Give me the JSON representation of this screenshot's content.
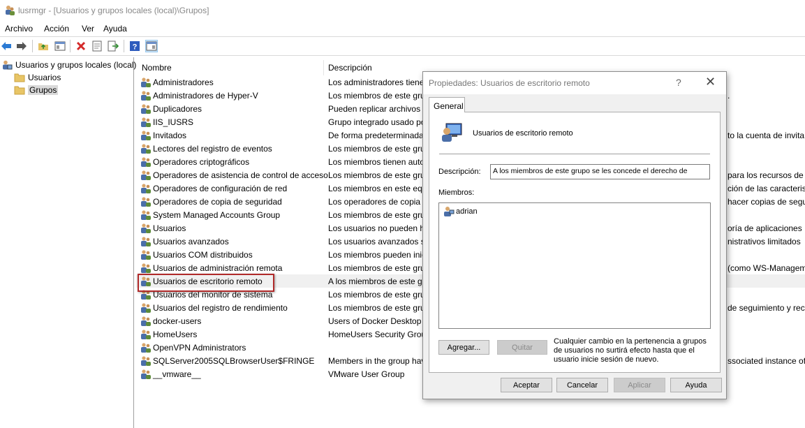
{
  "window": {
    "title": "lusrmgr - [Usuarios y grupos locales (local)\\Grupos]"
  },
  "menu": [
    "Archivo",
    "Acción",
    "Ver",
    "Ayuda"
  ],
  "toolbar": {
    "icons": [
      "back-arrow-icon",
      "forward-arrow-icon",
      "up-folder-icon",
      "show-hide-tree-icon",
      "delete-icon",
      "properties-icon",
      "export-list-icon",
      "help-icon",
      "show-hide-action-pane-icon"
    ]
  },
  "tree": {
    "root": "Usuarios y grupos locales (local)",
    "children": [
      "Usuarios",
      "Grupos"
    ]
  },
  "list": {
    "columns": [
      "Nombre",
      "Descripción"
    ],
    "rows": [
      {
        "name": "Administradores",
        "desc": "Los administradores tiene"
      },
      {
        "name": "Administradores de Hyper-V",
        "desc": "Los miembros de este gru"
      },
      {
        "name": "Duplicadores",
        "desc": "Pueden replicar archivos e"
      },
      {
        "name": "IIS_IUSRS",
        "desc": "Grupo integrado usado po"
      },
      {
        "name": "Invitados",
        "desc": "De forma predeterminada"
      },
      {
        "name": "Lectores del registro de eventos",
        "desc": "Los miembros de este gru"
      },
      {
        "name": "Operadores criptográficos",
        "desc": "Los miembros tienen auto"
      },
      {
        "name": "Operadores de asistencia de control de acceso",
        "desc": "Los miembros de este gru"
      },
      {
        "name": "Operadores de configuración de red",
        "desc": "Los miembros en este equ"
      },
      {
        "name": "Operadores de copia de seguridad",
        "desc": "Los operadores de copia d"
      },
      {
        "name": "System Managed Accounts Group",
        "desc": "Los miembros de este gru"
      },
      {
        "name": "Usuarios",
        "desc": "Los usuarios no pueden h"
      },
      {
        "name": "Usuarios avanzados",
        "desc": "Los usuarios avanzados se"
      },
      {
        "name": "Usuarios COM distribuidos",
        "desc": "Los miembros pueden inic"
      },
      {
        "name": "Usuarios de administración remota",
        "desc": "Los miembros de este gru"
      },
      {
        "name": "Usuarios de escritorio remoto",
        "desc": "A los miembros de este gr"
      },
      {
        "name": "Usuarios del monitor de sistema",
        "desc": "Los miembros de este gru"
      },
      {
        "name": "Usuarios del registro de rendimiento",
        "desc": "Los miembros de este gru"
      },
      {
        "name": "docker-users",
        "desc": "Users of Docker Desktop"
      },
      {
        "name": "HomeUsers",
        "desc": "HomeUsers Security Group"
      },
      {
        "name": "OpenVPN Administrators",
        "desc": ""
      },
      {
        "name": "SQLServer2005SQLBrowserUser$FRINGE",
        "desc": "Members in the group hav"
      },
      {
        "name": "__vmware__",
        "desc": "VMware User Group"
      }
    ],
    "overflow_desc": [
      {
        "row": 1,
        "text": "."
      },
      {
        "row": 4,
        "text": "to la cuenta de invita"
      },
      {
        "row": 7,
        "text": "para los recursos de e"
      },
      {
        "row": 8,
        "text": "ción de las caracterist"
      },
      {
        "row": 9,
        "text": "hacer copias de segur"
      },
      {
        "row": 11,
        "text": "oría de aplicaciones"
      },
      {
        "row": 12,
        "text": "nistrativos limitados"
      },
      {
        "row": 14,
        "text": "(como WS-Managem"
      },
      {
        "row": 17,
        "text": "de seguimiento y rec"
      },
      {
        "row": 21,
        "text": "ssociated instance of"
      }
    ],
    "selected_row": 15
  },
  "dialog": {
    "title": "Propiedades: Usuarios de escritorio remoto",
    "help_glyph": "?",
    "close_glyph": "✕",
    "tab": "General",
    "group_name": "Usuarios de escritorio remoto",
    "description_label": "Descripción:",
    "description_value": "A los miembros de este grupo se les concede el derecho de",
    "members_label": "Miembros:",
    "members": [
      "adrian"
    ],
    "add_button": "Agregar...",
    "remove_button": "Quitar",
    "note": "Cualquier cambio en la pertenencia a grupos de usuarios no surtirá efecto hasta que el usuario inicie sesión de nuevo.",
    "ok_button": "Aceptar",
    "cancel_button": "Cancelar",
    "apply_button": "Aplicar",
    "help_button": "Ayuda"
  }
}
